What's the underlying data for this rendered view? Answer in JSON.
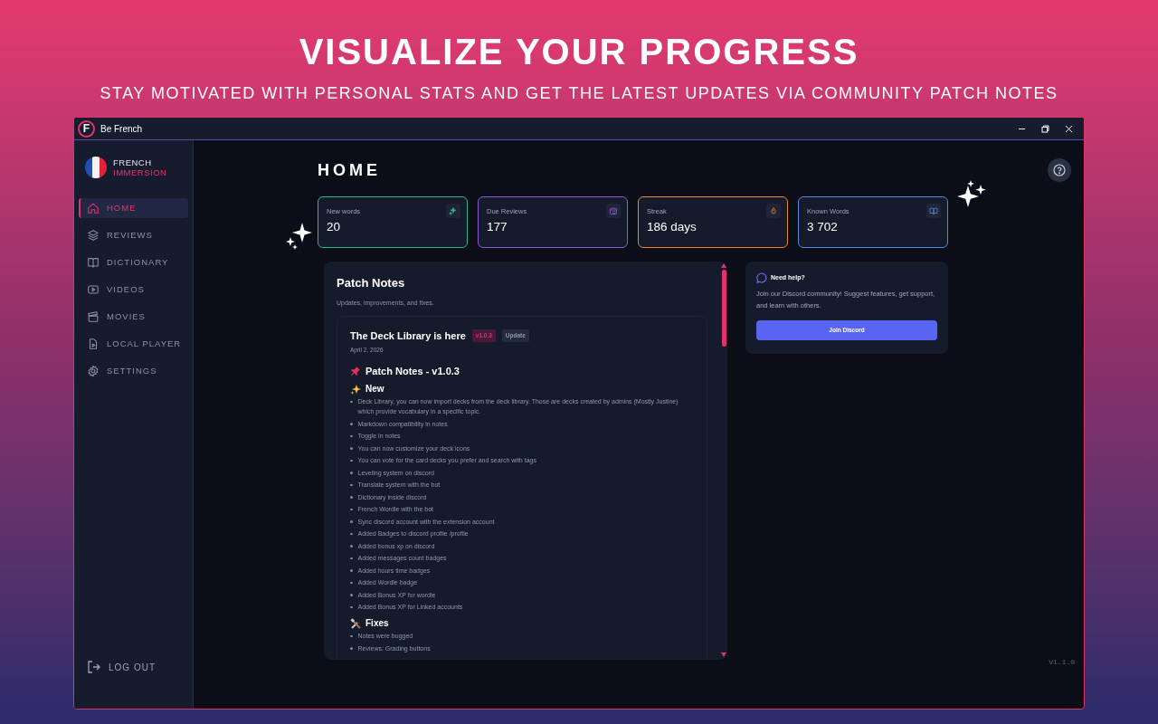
{
  "banner": {
    "title": "VISUALIZE YOUR PROGRESS",
    "subtitle": "STAY MOTIVATED WITH PERSONAL STATS AND GET THE LATEST UPDATES VIA COMMUNITY PATCH NOTES"
  },
  "window": {
    "title": "Be French",
    "logo_letter": "F"
  },
  "brand": {
    "line1": "FRENCH",
    "line2": "IMMERSION"
  },
  "sidebar": {
    "items": [
      {
        "label": "HOME",
        "selected": true
      },
      {
        "label": "REVIEWS",
        "selected": false
      },
      {
        "label": "DICTIONARY",
        "selected": false
      },
      {
        "label": "VIDEOS",
        "selected": false
      },
      {
        "label": "MOVIES",
        "selected": false
      },
      {
        "label": "LOCAL PLAYER",
        "selected": false
      },
      {
        "label": "SETTINGS",
        "selected": false
      }
    ],
    "logout": "LOG OUT"
  },
  "page_title": "HOME",
  "stats": [
    {
      "label": "New words",
      "value": "20",
      "color": "#2fb889"
    },
    {
      "label": "Due Reviews",
      "value": "177",
      "color": "#8b5cd6"
    },
    {
      "label": "Streak",
      "value": "186 days",
      "color": "#e9883a"
    },
    {
      "label": "Known Words",
      "value": "3 702",
      "color": "#4a8fe0"
    }
  ],
  "patch_notes": {
    "title": "Patch Notes",
    "subtitle": "Updates, improvements, and fixes.",
    "entry": {
      "title": "The Deck Library is here",
      "version": "v1.0.3",
      "tag": "Update",
      "date": "April 2, 2026",
      "heading": "Patch Notes - v1.0.3",
      "sections": [
        {
          "title": "New",
          "items": [
            "Deck Library, you can now import decks from the deck library. Those are decks created by admins (Mostly Justine) which provide vocabulary in a specific topic.",
            "Markdown compatibility in notes",
            "Toggle in notes",
            "You can now customize your deck icons",
            "You can vote for the card decks you prefer and search with tags",
            "Leveling system on discord",
            "Translate system with the bot",
            "Dictionary inside discord",
            "French Wordle with the bot",
            "Sync discord account with the extension account",
            "Added Badges to discord profile /profile",
            "Added bonus xp on discord",
            "Added messages count badges",
            "Added hours time badges",
            "Added Wordle badge",
            "Added Bonus XP for wordle",
            "Added Bonus XP for Linked accounts"
          ]
        },
        {
          "title": "Fixes",
          "items": [
            "Notes were bugged",
            "Reviews: Grading buttons"
          ]
        }
      ]
    }
  },
  "help": {
    "title": "Need help?",
    "text": "Join our Discord community! Suggest features, get support, and learn with others.",
    "button": "Join Discord"
  },
  "version": "V1.1.0"
}
